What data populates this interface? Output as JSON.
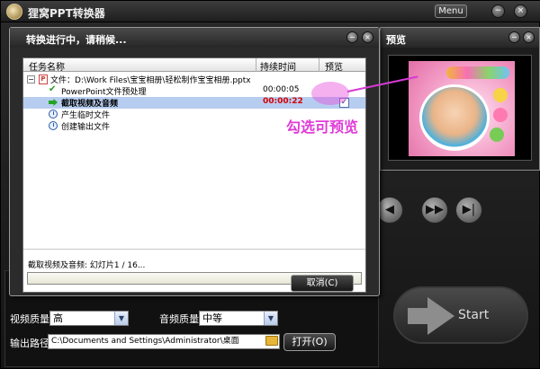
{
  "app": {
    "title": "狸窝PPT转换器",
    "menu_label": "Menu"
  },
  "dialog": {
    "title": "转换进行中，请稍候...",
    "columns": {
      "name": "任务名称",
      "duration": "持续时间",
      "preview": "预览"
    },
    "file_row": {
      "expander": "−",
      "label": "文件：D:\\Work Files\\宝宝相册\\轻松制作宝宝相册.pptx"
    },
    "tasks": [
      {
        "label": "PowerPoint文件预处理",
        "time": "00:00:05",
        "status": "done"
      },
      {
        "label": "截取视频及音频",
        "time": "00:00:22",
        "status": "in-progress",
        "preview_checked": "✓"
      },
      {
        "label": "产生临时文件",
        "time": "",
        "status": "pending"
      },
      {
        "label": "创建输出文件",
        "time": "",
        "status": "pending"
      }
    ],
    "status_text": "截取视频及音频: 幻灯片1 / 16...",
    "progress": 0,
    "cancel_label": "取消(C)"
  },
  "annotation": {
    "text": "勾选可预览",
    "color": "#e03ad8"
  },
  "preview_window": {
    "title": "预览"
  },
  "settings": {
    "video_quality_label": "视频质量:",
    "video_quality_value": "高",
    "audio_quality_label": "音频质量:",
    "audio_quality_value": "中等",
    "output_path_label": "输出路径:",
    "output_path_value": "C:\\Documents and Settings\\Administrator\\桌面",
    "open_label": "打开(O)"
  },
  "start_label": "Start",
  "icons": {
    "app_logo": "app-logo-icon",
    "done": "check-icon",
    "in_progress": "green-arrow-icon",
    "pending": "clock-icon",
    "file": "ppt-file-icon",
    "folder": "folder-icon"
  },
  "colors": {
    "selected_row": "#b7cdf0",
    "active_time": "#d40000",
    "accent": "#e03ad8"
  }
}
